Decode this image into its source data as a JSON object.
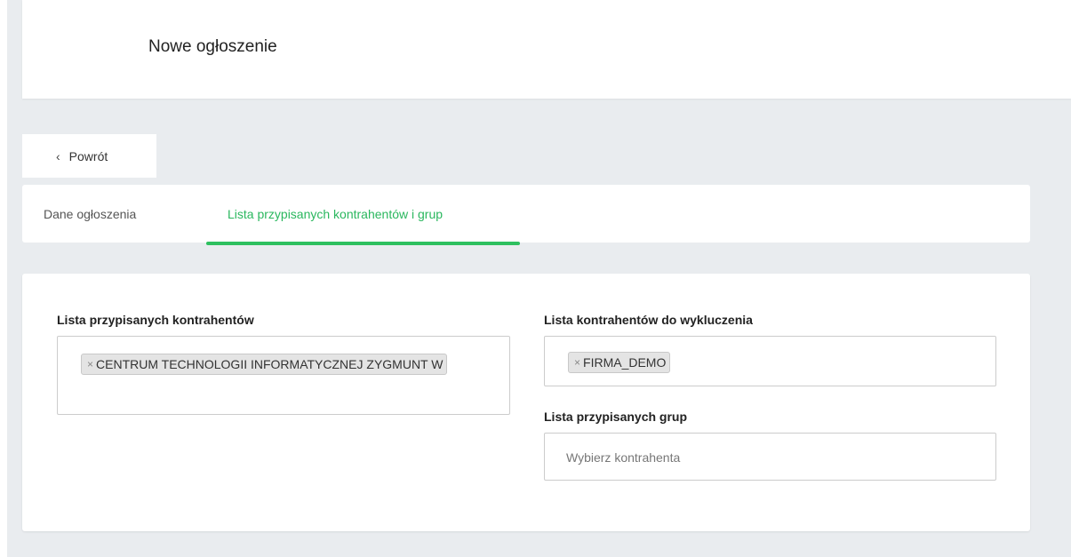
{
  "header": {
    "title": "Nowe ogłoszenie"
  },
  "back": {
    "chevron": "‹",
    "label": "Powrót"
  },
  "tabs": [
    {
      "label": "Dane ogłoszenia",
      "active": false
    },
    {
      "label": "Lista przypisanych kontrahentów i grup",
      "active": true
    }
  ],
  "assigned": {
    "label": "Lista przypisanych kontrahentów",
    "tags": [
      {
        "remove": "×",
        "text": "CENTRUM TECHNOLOGII INFORMATYCZNEJ ZYGMUNT W"
      }
    ]
  },
  "excluded": {
    "label": "Lista kontrahentów do wykluczenia",
    "tags": [
      {
        "remove": "×",
        "text": "FIRMA_DEMO"
      }
    ]
  },
  "groups": {
    "label": "Lista przypisanych grup",
    "placeholder": "Wybierz kontrahenta"
  },
  "colors": {
    "accent": "#2ec05f",
    "accent_text": "#2ab75e",
    "page_bg": "#e9ecef"
  },
  "icons": {
    "back": "chevron-left-icon",
    "remove": "close-icon"
  }
}
